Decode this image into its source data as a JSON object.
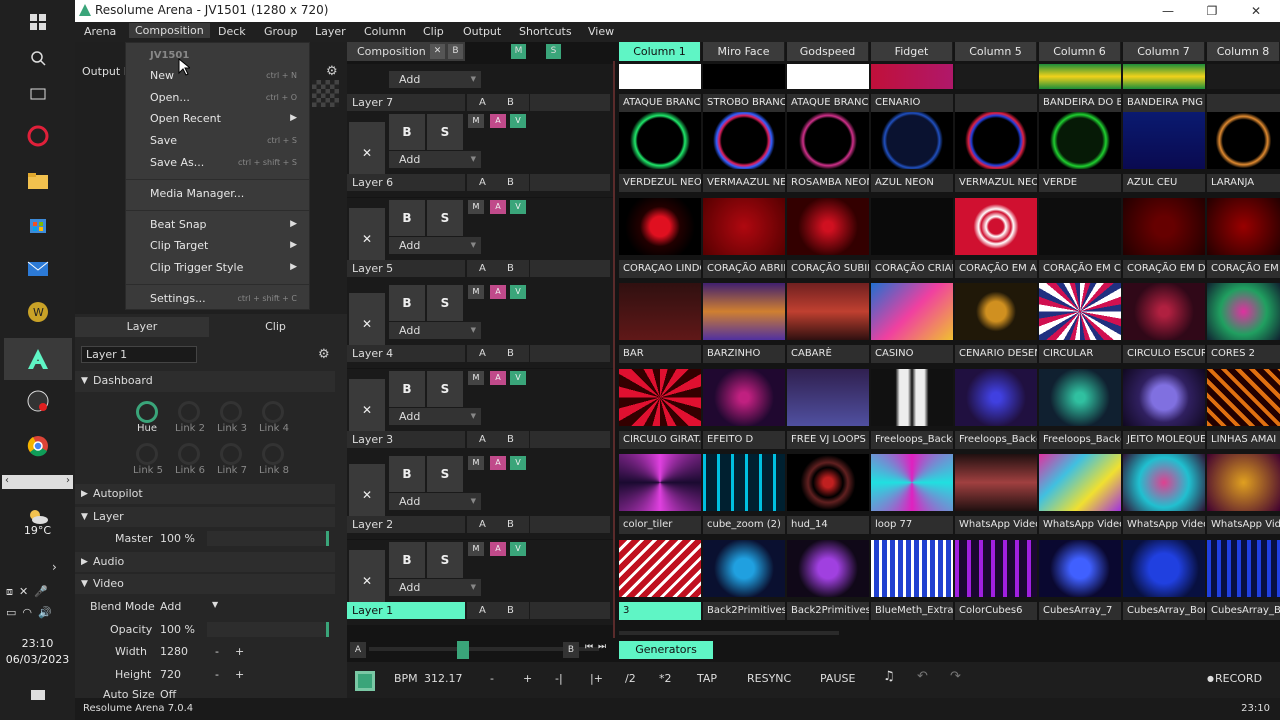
{
  "window": {
    "title": "Resolume Arena - JV1501 (1280 x 720)",
    "min": "—",
    "restore": "❐",
    "close": "✕"
  },
  "menu": [
    "Arena",
    "Composition",
    "Deck",
    "Group",
    "Layer",
    "Column",
    "Clip",
    "Output",
    "Shortcuts",
    "View"
  ],
  "dropdown": {
    "header": "JV1501",
    "items": [
      {
        "label": "New",
        "shortcut": "ctrl + N"
      },
      {
        "label": "Open...",
        "shortcut": "ctrl + O"
      },
      {
        "label": "Open Recent",
        "submenu": "▶"
      },
      {
        "label": "Save",
        "shortcut": "ctrl + S"
      },
      {
        "label": "Save As...",
        "shortcut": "ctrl + shift + S"
      },
      {
        "label": "Media Manager..."
      },
      {
        "label": "Beat Snap",
        "submenu": "▶"
      },
      {
        "label": "Clip Target",
        "submenu": "▶"
      },
      {
        "label": "Clip Trigger Style",
        "submenu": "▶"
      },
      {
        "label": "Settings...",
        "shortcut": "ctrl + shift + C"
      }
    ]
  },
  "left": {
    "output_label": "Output M",
    "tabs": [
      "Layer",
      "Clip"
    ],
    "layer_name": "Layer 1",
    "dashboard": "Dashboard",
    "knobs": [
      "Hue",
      "Link 2",
      "Link 3",
      "Link 4",
      "Link 5",
      "Link 6",
      "Link 7",
      "Link 8"
    ],
    "autopilot": "Autopilot",
    "layer": "Layer",
    "master_label": "Master",
    "master_value": "100 %",
    "audio": "Audio",
    "video": "Video",
    "blend_label": "Blend Mode",
    "blend_value": "Add",
    "opacity_label": "Opacity",
    "opacity_value": "100 %",
    "width_label": "Width",
    "width_value": "1280",
    "height_label": "Height",
    "height_value": "720",
    "autosize_label": "Auto Size",
    "autosize_value": "Off",
    "minus": "-",
    "plus": "+"
  },
  "composition": {
    "label": "Composition",
    "x": "✕",
    "b": "B",
    "m": "M",
    "s": "S"
  },
  "columns": [
    "Column 1",
    "Miro Face",
    "Godspeed",
    "Fidget",
    "Column 5",
    "Column 6",
    "Column 7",
    "Column 8"
  ],
  "layers": [
    {
      "name": "Layer 7",
      "clips": [
        "ATAQUE BRANCO",
        "STROBO BRANCO",
        "ATAQUE BRANCO",
        "CENARIO",
        "",
        "BANDEIRA DO B...",
        "BANDEIRA PNG",
        ""
      ]
    },
    {
      "name": "Layer 6",
      "clips": [
        "VERDEZUL NEON",
        "VERMAAZUL NEON",
        "ROSAMBA NEON",
        "AZUL NEON",
        "VERMAZUL NEON",
        "VERDE",
        "AZUL CEU",
        "LARANJA"
      ]
    },
    {
      "name": "Layer 5",
      "clips": [
        "CORAÇAO LINDO",
        "CORAÇÃO ABRINDO",
        "CORAÇÃO SUBINDO",
        "CORAÇÃO CRIAD...",
        "CORAÇÃO EM AB...",
        "CORAÇÃO EM CI...",
        "CORAÇÃO EM DI...",
        "CORAÇÃO EM"
      ]
    },
    {
      "name": "Layer 4",
      "clips": [
        "BAR",
        "BARZINHO",
        "CABARÈ",
        "CASINO",
        "CENARIO DESENHO",
        "CIRCULAR",
        "CIRCULO ESCURO",
        "CORES 2"
      ]
    },
    {
      "name": "Layer 3",
      "clips": [
        "CIRCULO GIRAT...",
        "EFEITO D",
        "FREE VJ LOOPS HD",
        "Freeloops_Backg...",
        "Freeloops_Backg...",
        "Freeloops_Backg...",
        "JEITO MOLEQUE ...",
        "LINHAS AMAI"
      ]
    },
    {
      "name": "Layer 2",
      "clips": [
        "color_tiler",
        "cube_zoom (2)",
        "hud_14",
        "loop 77",
        "WhatsApp Video ...",
        "WhatsApp Video ...",
        "WhatsApp Video ...",
        "WhatsApp Vid"
      ]
    },
    {
      "name": "Layer 1",
      "clips": [
        "3",
        "Back2Primitives_",
        "Back2Primitives_4",
        "BlueMeth_Extra (2)",
        "ColorCubes6",
        "CubesArray_7",
        "CubesArray_Bon...",
        "CubesArray_B"
      ]
    }
  ],
  "layer_ctl": {
    "x": "✕",
    "b": "B",
    "s": "S",
    "add": "Add",
    "m": "M",
    "a": "A",
    "v": "V",
    "ab_a": "A",
    "ab_b": "B"
  },
  "crossfader": {
    "a": "A",
    "b": "B"
  },
  "deck": {
    "generators": "Generators"
  },
  "transport": {
    "bpm_label": "BPM",
    "bpm": "312.17",
    "minus": "-",
    "plus": "+",
    "nudge_l": "-|",
    "nudge_r": "|+",
    "half": "/2",
    "double": "*2",
    "tap": "TAP",
    "resync": "RESYNC",
    "pause": "PAUSE",
    "record": "RECORD"
  },
  "status": {
    "version": "Resolume Arena 7.0.4",
    "time": "23:10"
  },
  "taskbar": {
    "temp": "19°C",
    "time": "23:10",
    "date": "06/03/2023"
  },
  "colors": {
    "accent": "#5ff5c5",
    "knob_green": "#3aa57a"
  }
}
